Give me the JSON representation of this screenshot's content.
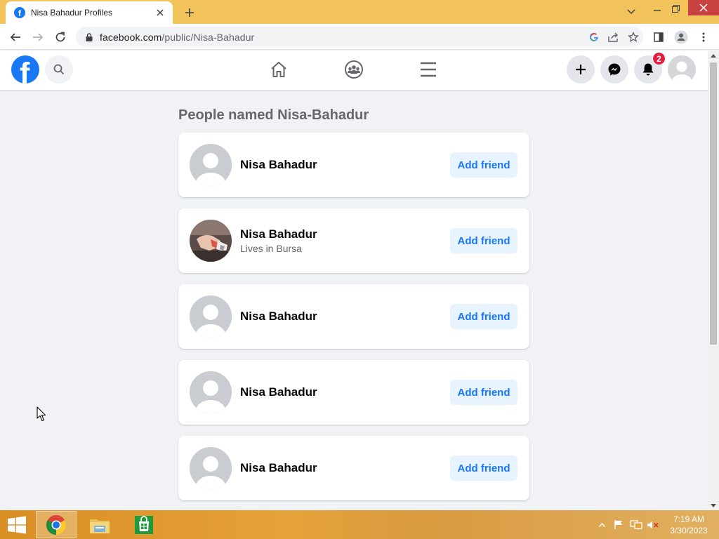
{
  "browser": {
    "tab_title": "Nisa Bahadur Profiles",
    "url_domain": "facebook.com",
    "url_path": "/public/Nisa-Bahadur"
  },
  "facebook": {
    "logo_letter": "f",
    "notification_count": "2"
  },
  "page": {
    "heading": "People named Nisa-Bahadur",
    "results": [
      {
        "name": "Nisa Bahadur",
        "subtitle": "",
        "button": "Add friend",
        "has_photo": false
      },
      {
        "name": "Nisa Bahadur",
        "subtitle": "Lives in Bursa",
        "button": "Add friend",
        "has_photo": true
      },
      {
        "name": "Nisa Bahadur",
        "subtitle": "",
        "button": "Add friend",
        "has_photo": false
      },
      {
        "name": "Nisa Bahadur",
        "subtitle": "",
        "button": "Add friend",
        "has_photo": false
      },
      {
        "name": "Nisa Bahadur",
        "subtitle": "",
        "button": "Add friend",
        "has_photo": false
      }
    ]
  },
  "taskbar": {
    "time": "7:19 AM",
    "date": "3/30/2023"
  }
}
